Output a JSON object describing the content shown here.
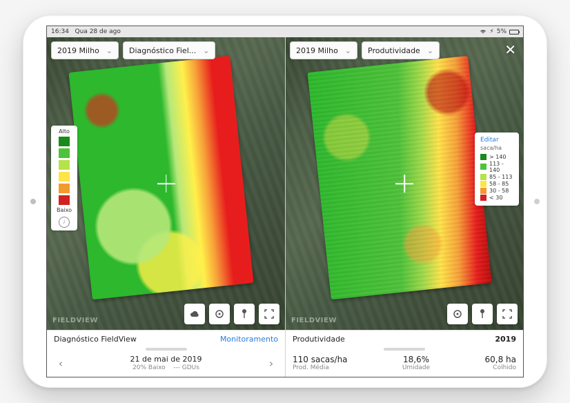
{
  "statusbar": {
    "time": "16:34",
    "date": "Qua 28 de ago",
    "battery_text": "5%"
  },
  "close_label": "✕",
  "watermark": "FIELDVIEW",
  "left_pane": {
    "dropdown1": "2019 Milho",
    "dropdown2": "Diagnóstico Fiel...",
    "legend_top": "Alto",
    "legend_bottom": "Baixo",
    "footer": {
      "title": "Diagnóstico FieldView",
      "link": "Monitoramento",
      "date": "21 de mai de 2019",
      "sub_left": "20% Baixo",
      "sub_right": "--- GDUs"
    }
  },
  "right_pane": {
    "dropdown1": "2019 Milho",
    "dropdown2": "Produtividade",
    "legend": {
      "edit": "Editar",
      "unit": "saca/ha",
      "rows": [
        {
          "label": "> 140",
          "color": "#1a8a1a"
        },
        {
          "label": "113 - 140",
          "color": "#4fc23a"
        },
        {
          "label": "85 - 113",
          "color": "#b6e24a"
        },
        {
          "label": "58 - 85",
          "color": "#ffe34a"
        },
        {
          "label": "30 - 58",
          "color": "#f29a2e"
        },
        {
          "label": "< 30",
          "color": "#d32020"
        }
      ]
    },
    "footer": {
      "title": "Produtividade",
      "year": "2019",
      "val1": "110 sacas/ha",
      "lab1": "Prod. Média",
      "val2": "18,6%",
      "lab2": "Umidade",
      "val3": "60,8 ha",
      "lab3": "Colhido"
    }
  }
}
